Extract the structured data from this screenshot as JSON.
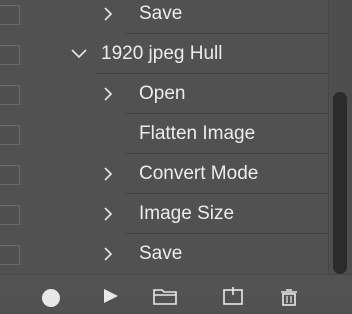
{
  "actions_panel": {
    "rows": [
      {
        "label": "Save",
        "kind": "step",
        "expandable": true
      },
      {
        "label": "1920 jpeg Hull",
        "kind": "action",
        "expanded": true
      },
      {
        "label": "Open",
        "kind": "step",
        "expandable": true
      },
      {
        "label": "Flatten Image",
        "kind": "step",
        "expandable": false
      },
      {
        "label": "Convert Mode",
        "kind": "step",
        "expandable": true
      },
      {
        "label": "Image Size",
        "kind": "step",
        "expandable": true
      },
      {
        "label": "Save",
        "kind": "step",
        "expandable": true
      }
    ]
  },
  "toolbar": {
    "icons": [
      "record-icon",
      "play-icon",
      "new-set-folder-icon",
      "new-action-icon",
      "delete-trash-icon"
    ]
  },
  "colors": {
    "panel_bg": "#515151",
    "text": "#ececec",
    "divider": "#3f3f3f",
    "scroll_thumb": "#2b2b2b"
  }
}
